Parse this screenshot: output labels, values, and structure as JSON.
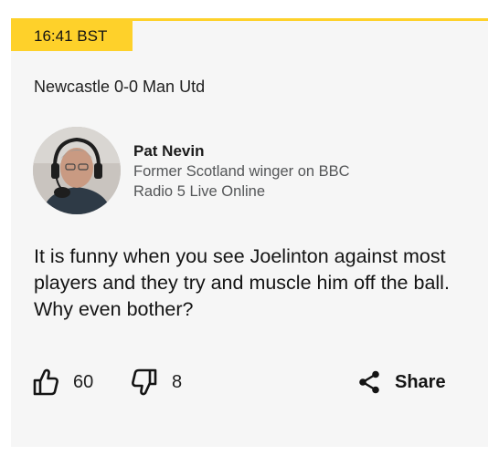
{
  "post": {
    "time": "16:41 BST",
    "headline": "Newcastle 0-0 Man Utd",
    "author": {
      "name": "Pat Nevin",
      "role": "Former Scotland winger on BBC Radio 5 Live Online"
    },
    "quote": "It is funny when you see Joelinton against most players and they try and muscle him off the ball. Why even bother?",
    "actions": {
      "likes": "60",
      "dislikes": "8",
      "share_label": "Share"
    },
    "colors": {
      "accent": "#fed12a",
      "card_background": "#f6f6f6"
    },
    "icons": [
      "thumbs-up-icon",
      "thumbs-down-icon",
      "share-icon"
    ]
  }
}
